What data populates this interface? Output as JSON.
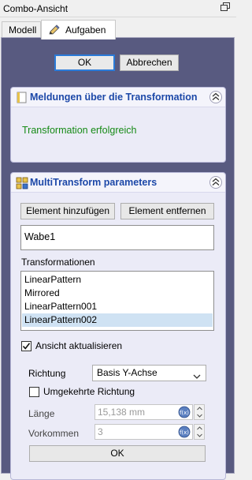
{
  "window": {
    "title": "Combo-Ansicht"
  },
  "tabs": [
    {
      "label": "Modell"
    },
    {
      "label": "Aufgaben"
    }
  ],
  "dialog": {
    "ok_label": "OK",
    "cancel_label": "Abbrechen"
  },
  "messages_box": {
    "title": "Meldungen über die Transformation",
    "message": "Transformation erfolgreich",
    "message_color": "#168a16"
  },
  "multitransform": {
    "title": "MultiTransform parameters",
    "add_element_label": "Element hinzufügen",
    "remove_element_label": "Element entfernen",
    "features": [
      "Wabe1"
    ],
    "transformations_label": "Transformationen",
    "transformations": [
      {
        "label": "LinearPattern",
        "selected": false
      },
      {
        "label": "Mirrored",
        "selected": false
      },
      {
        "label": "LinearPattern001",
        "selected": false
      },
      {
        "label": "LinearPattern002",
        "selected": true
      }
    ],
    "update_view_label": "Ansicht aktualisieren",
    "update_view_checked": true,
    "direction_label": "Richtung",
    "direction_value": "Basis Y-Achse",
    "reverse_label": "Umgekehrte Richtung",
    "reverse_checked": false,
    "length_label": "Länge",
    "length_value": "15,138 mm",
    "occurrences_label": "Vorkommen",
    "occurrences_value": "3",
    "ok_label": "OK"
  },
  "colors": {
    "panel_bg": "#585a80",
    "header_title": "#1c48a8",
    "selection": "#cfe2f3",
    "focus": "#2b7bd8"
  }
}
